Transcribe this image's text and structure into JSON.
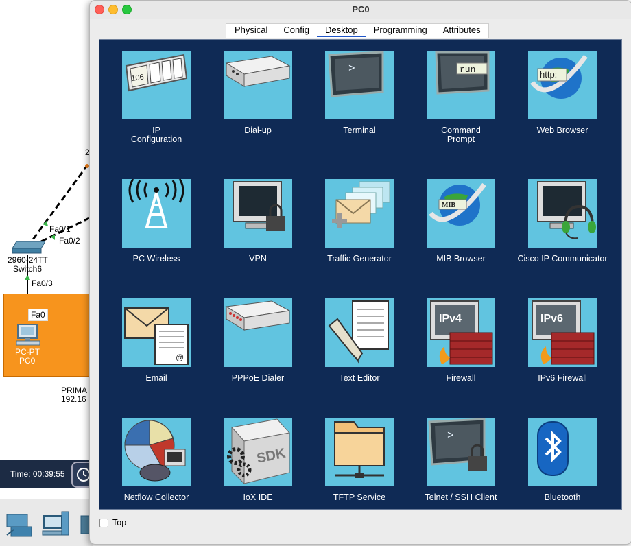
{
  "background": {
    "device_switch": {
      "model": "2960-24TT",
      "name": "Switch6",
      "ports": [
        "Fa0/1",
        "Fa0/2",
        "Fa0/3"
      ]
    },
    "device_pc": {
      "port": "Fa0",
      "type": "PC-PT",
      "name": "PC0"
    },
    "truncated_label": "2",
    "network_label_1": "PRIMA",
    "network_label_2": "192.16",
    "time_label": "Time: 00:39:55"
  },
  "window": {
    "title": "PC0",
    "tabs": [
      "Physical",
      "Config",
      "Desktop",
      "Programming",
      "Attributes"
    ],
    "active_tab": "Desktop",
    "footer_checkbox_label": "Top"
  },
  "apps": [
    {
      "label": "IP\nConfiguration",
      "icon": "ip-config-icon"
    },
    {
      "label": "Dial-up",
      "icon": "modem-icon"
    },
    {
      "label": "Terminal",
      "icon": "terminal-icon"
    },
    {
      "label": "Command\nPrompt",
      "icon": "run-prompt-icon",
      "icon_text": "run"
    },
    {
      "label": "Web Browser",
      "icon": "globe-http-icon",
      "icon_text": "http:"
    },
    {
      "label": "PC Wireless",
      "icon": "antenna-icon"
    },
    {
      "label": "VPN",
      "icon": "monitor-lock-icon"
    },
    {
      "label": "Traffic Generator",
      "icon": "envelope-stack-icon"
    },
    {
      "label": "MIB Browser",
      "icon": "globe-mib-icon",
      "icon_text": "MIB"
    },
    {
      "label": "Cisco IP Communicator",
      "icon": "monitor-headset-icon"
    },
    {
      "label": "Email",
      "icon": "envelope-letter-icon"
    },
    {
      "label": "PPPoE Dialer",
      "icon": "dialer-box-icon"
    },
    {
      "label": "Text Editor",
      "icon": "pencil-document-icon"
    },
    {
      "label": "Firewall",
      "icon": "firewall-ipv4-icon",
      "icon_text": "IPv4"
    },
    {
      "label": "IPv6 Firewall",
      "icon": "firewall-ipv6-icon",
      "icon_text": "IPv6"
    },
    {
      "label": "Netflow Collector",
      "icon": "pie-router-icon"
    },
    {
      "label": "IoX IDE",
      "icon": "sdk-gears-icon",
      "icon_text": "SDK"
    },
    {
      "label": "TFTP Service",
      "icon": "folder-network-icon"
    },
    {
      "label": "Telnet / SSH Client",
      "icon": "terminal-lock-icon"
    },
    {
      "label": "Bluetooth",
      "icon": "bluetooth-icon"
    }
  ],
  "colors": {
    "desktop_bg": "#0f2a55",
    "tile_bg": "#61c4e0",
    "workspace_orange": "#f7941d",
    "active_tab_underline": "#1f55c8"
  }
}
